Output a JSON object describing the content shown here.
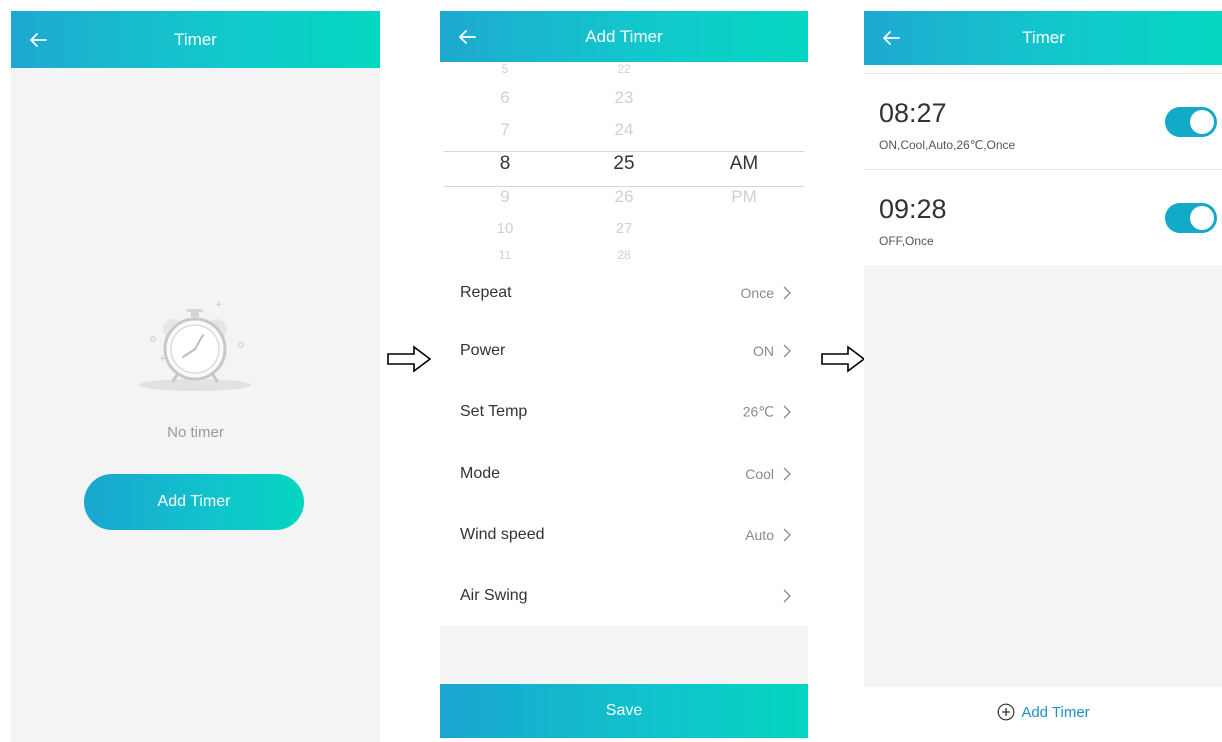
{
  "screen1": {
    "title": "Timer",
    "empty_text": "No timer",
    "add_button": "Add Timer",
    "icons": [
      "back-arrow-icon",
      "alarm-clock-icon"
    ]
  },
  "screen2": {
    "title": "Add Timer",
    "picker": {
      "hours": [
        "5",
        "6",
        "7",
        "8",
        "9",
        "10",
        "11"
      ],
      "minutes": [
        "22",
        "23",
        "24",
        "25",
        "26",
        "27",
        "28"
      ],
      "ampm": [
        "AM",
        "PM"
      ],
      "selected_hour": "8",
      "selected_minute": "25",
      "selected_ampm": "AM"
    },
    "settings": [
      {
        "label": "Repeat",
        "value": "Once"
      },
      {
        "label": "Power",
        "value": "ON"
      },
      {
        "label": "Set Temp",
        "value": "26℃"
      },
      {
        "label": "Mode",
        "value": "Cool"
      },
      {
        "label": "Wind speed",
        "value": "Auto"
      },
      {
        "label": "Air Swing",
        "value": ""
      }
    ],
    "save_button": "Save"
  },
  "screen3": {
    "title": "Timer",
    "timers": [
      {
        "time": "08:27",
        "desc": "ON,Cool,Auto,26℃,Once",
        "enabled": true
      },
      {
        "time": "09:28",
        "desc": "OFF,Once",
        "enabled": true
      }
    ],
    "add_link": "Add Timer"
  },
  "colors": {
    "header_gradient_start": "#1ea9d0",
    "header_gradient_end": "#05d8c2",
    "toggle_on": "#13a9c9",
    "link": "#1a8fc9"
  }
}
